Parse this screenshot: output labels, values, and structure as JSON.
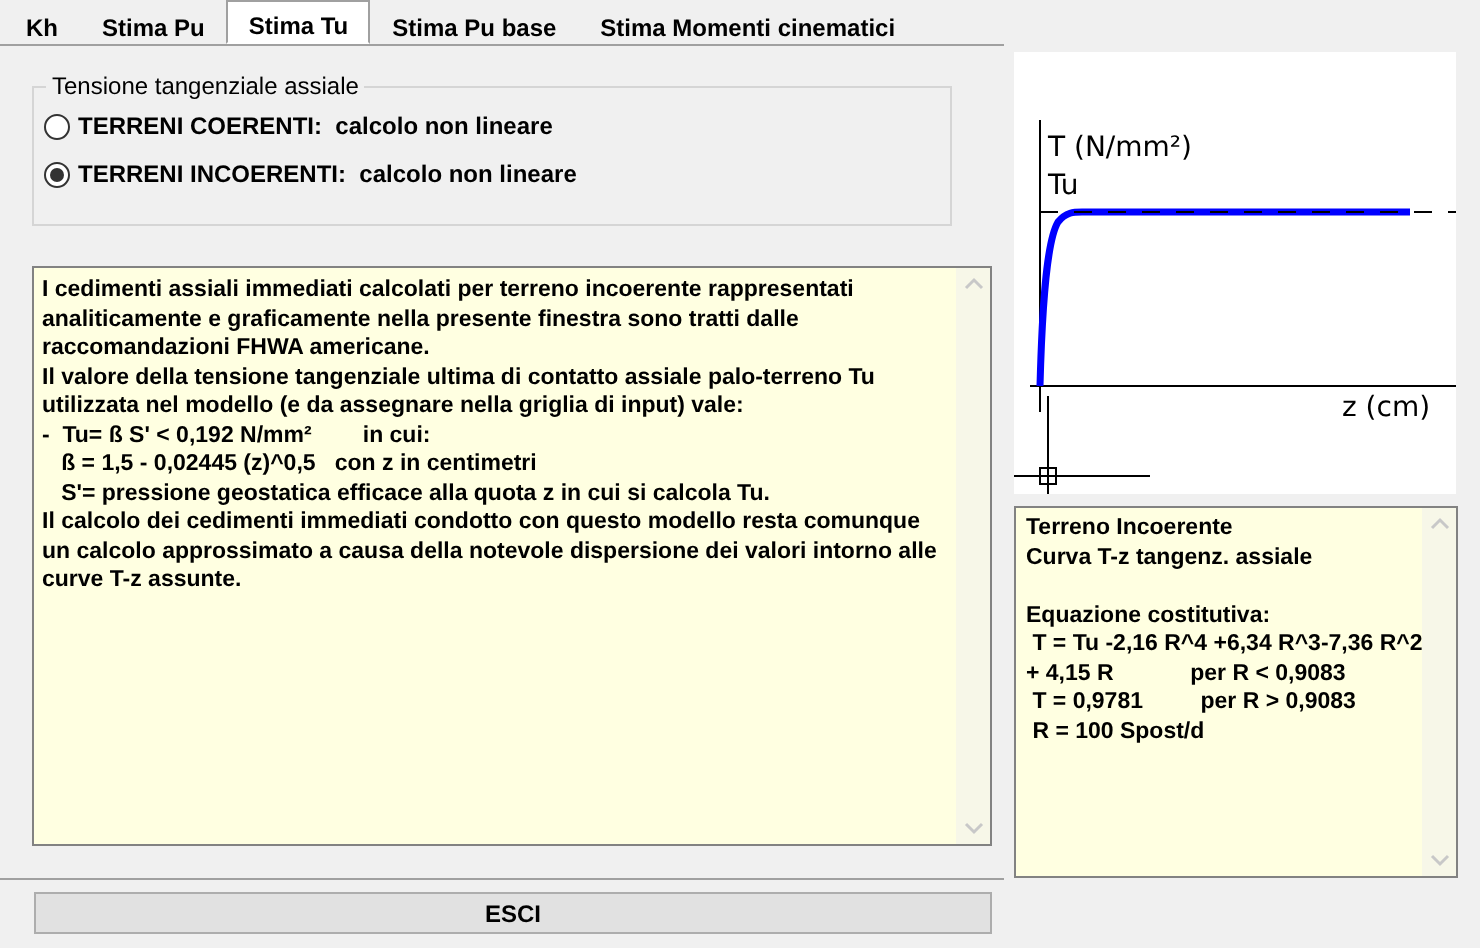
{
  "tabs": [
    {
      "label": "Kh",
      "selected": false
    },
    {
      "label": "Stima Pu",
      "selected": false
    },
    {
      "label": "Stima Tu",
      "selected": true
    },
    {
      "label": "Stima Pu base",
      "selected": false
    },
    {
      "label": "Stima Momenti cinematici",
      "selected": false
    }
  ],
  "group": {
    "title": "Tensione tangenziale assiale",
    "options": [
      {
        "label": "TERRENI COERENTI:  calcolo non lineare",
        "selected": false
      },
      {
        "label": "TERRENI INCOERENTI:  calcolo non lineare",
        "selected": true
      }
    ]
  },
  "description": {
    "lines": [
      "I cedimenti assiali immediati calcolati per terreno incoerente rappresentati",
      "analiticamente e graficamente nella presente finestra sono tratti dalle",
      "raccomandazioni FHWA americane.",
      "Il valore della tensione tangenziale ultima di contatto assiale palo-terreno Tu",
      "utilizzata nel modello (e da assegnare nella griglia di input) vale:",
      "-  Tu= ß S' < 0,192 N/mm²        in cui:",
      "   ß = 1,5 - 0,02445 (z)^0,5   con z in centimetri",
      "   S'= pressione geostatica efficace alla quota z in cui si calcola Tu.",
      "Il calcolo dei cedimenti immediati condotto con questo modello resta comunque",
      "un calcolo approssimato a causa della notevole dispersione dei valori intorno alle",
      "curve T-z assunte."
    ]
  },
  "chart": {
    "y_label": "T (N/mm²)",
    "limit_label": "Tu",
    "x_label": "z (cm)"
  },
  "info": {
    "heading": [
      "Terreno Incoerente",
      "Curva T-z tangenz. assiale"
    ],
    "equation": [
      "Equazione costitutiva:",
      " T = Tu -2,16 R^4 +6,34 R^3-7,36 R^2",
      "+ 4,15 R            per R < 0,9083",
      " T = 0,9781         per R > 0,9083",
      " R = 100 Spost/d"
    ]
  },
  "buttons": [
    {
      "label": "ESCI"
    }
  ]
}
